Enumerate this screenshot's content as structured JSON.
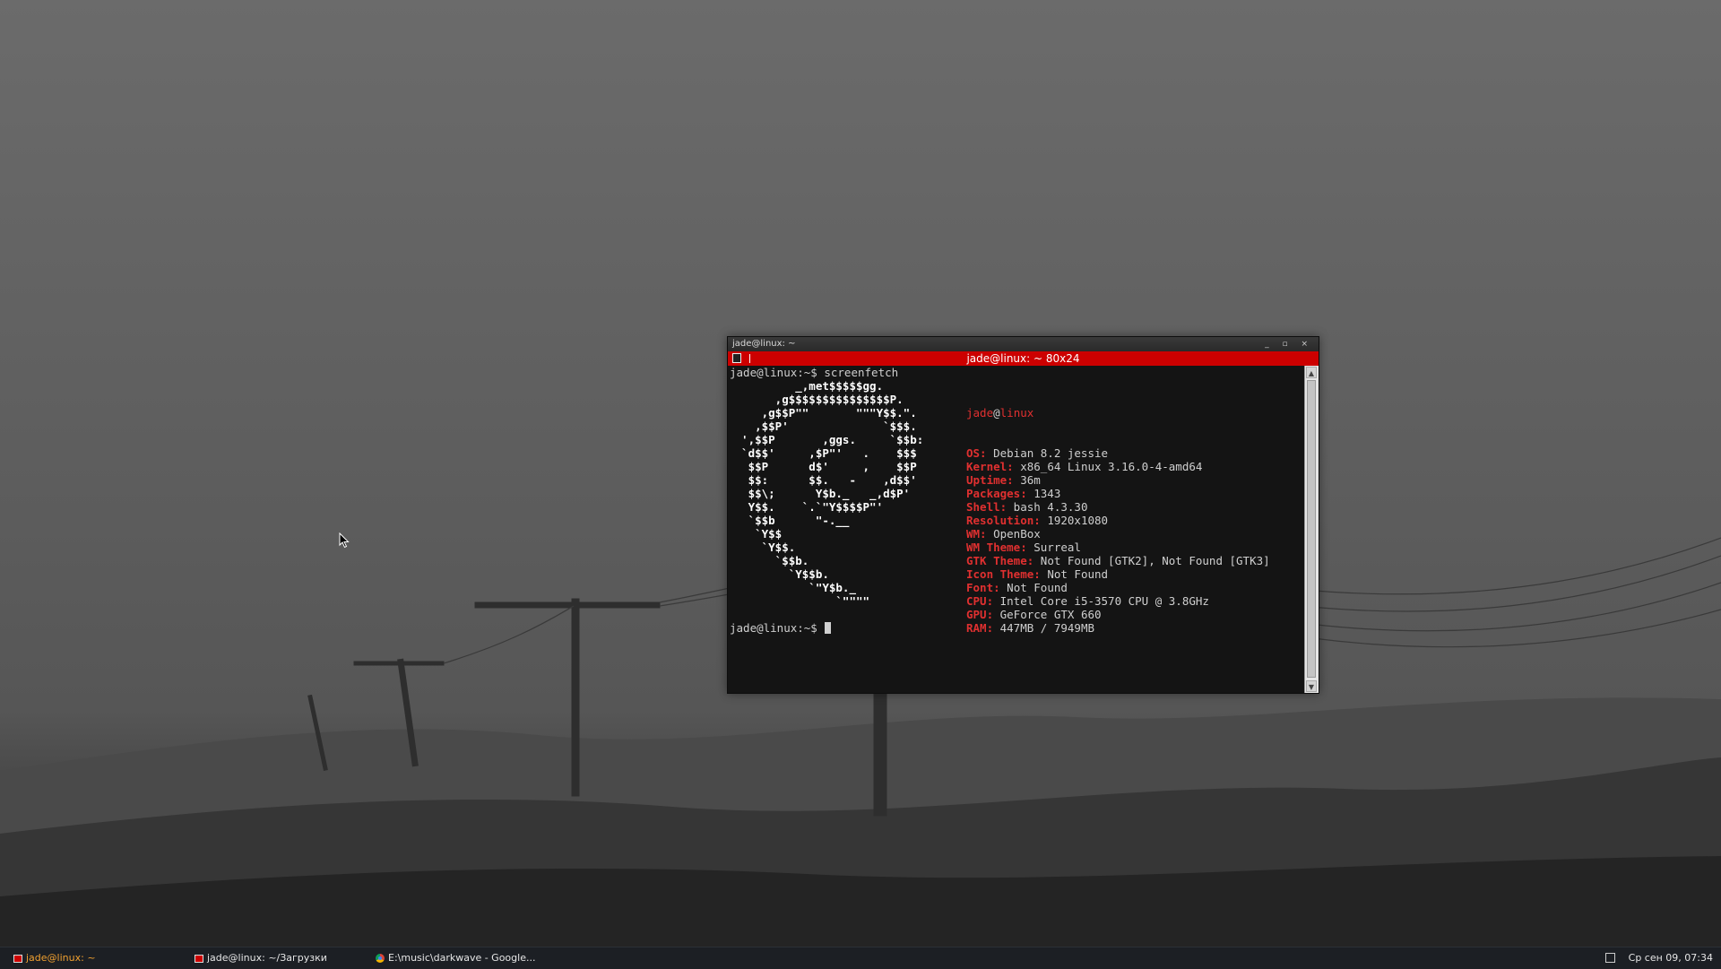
{
  "terminal": {
    "wm_title": "jade@linux: ~",
    "wm_buttons": "_ ▫ ×",
    "tab_title": "jade@linux: ~ 80x24",
    "prompt_line": "jade@linux:~$ screenfetch",
    "final_prompt": "jade@linux:~$ ",
    "user": "jade",
    "at": "@",
    "host": "linux",
    "info": [
      {
        "key": "OS:",
        "value": " Debian 8.2 jessie"
      },
      {
        "key": "Kernel:",
        "value": " x86_64 Linux 3.16.0-4-amd64"
      },
      {
        "key": "Uptime:",
        "value": " 36m"
      },
      {
        "key": "Packages:",
        "value": " 1343"
      },
      {
        "key": "Shell:",
        "value": " bash 4.3.30"
      },
      {
        "key": "Resolution:",
        "value": " 1920x1080"
      },
      {
        "key": "WM:",
        "value": " OpenBox"
      },
      {
        "key": "WM Theme:",
        "value": " Surreal"
      },
      {
        "key": "GTK Theme:",
        "value": " Not Found [GTK2], Not Found [GTK3]"
      },
      {
        "key": "Icon Theme:",
        "value": " Not Found"
      },
      {
        "key": "Font:",
        "value": " Not Found"
      },
      {
        "key": "CPU:",
        "value": " Intel Core i5-3570 CPU @ 3.8GHz"
      },
      {
        "key": "GPU:",
        "value": " GeForce GTX 660"
      },
      {
        "key": "RAM:",
        "value": " 447MB / 7949MB"
      }
    ],
    "logo": [
      "          _,met$$$$$gg.",
      "       ,g$$$$$$$$$$$$$$$P.",
      "     ,g$$P\"\"       \"\"\"Y$$.\".",
      "    ,$$P'              `$$$.",
      "  ',$$P       ,ggs.     `$$b:",
      "  `d$$'     ,$P\"'   .    $$$",
      "   $$P      d$'     ,    $$P",
      "   $$:      $$.   -    ,d$$'",
      "   $$\\;      Y$b._   _,d$P'",
      "   Y$$.    `.`\"Y$$$$P\"'",
      "   `$$b      \"-.__",
      "    `Y$$",
      "     `Y$$.",
      "       `$$b.",
      "         `Y$$b.",
      "            `\"Y$b._",
      "                `\"\"\"\""
    ]
  },
  "taskbar": {
    "tasks": [
      {
        "label": "jade@linux: ~",
        "icon": "terminal-icon",
        "active": true
      },
      {
        "label": "jade@linux: ~/Загрузки",
        "icon": "terminal-icon",
        "active": false
      },
      {
        "label": "E:\\music\\darkwave - Google...",
        "icon": "chrome-icon",
        "active": false
      }
    ],
    "clock": "Ср сен 09, 07:34",
    "tray_icon": "chat-icon"
  },
  "colors": {
    "accent_red": "#cc0000",
    "active_task": "#f0a030",
    "terminal_bg": "#1b1b1b"
  }
}
